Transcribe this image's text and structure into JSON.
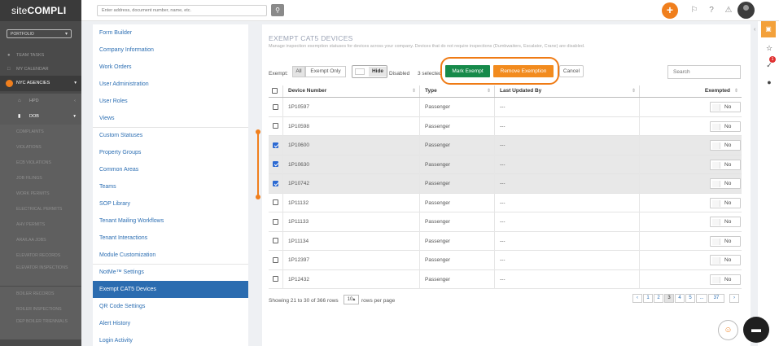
{
  "topbar": {
    "logo_light": "site",
    "logo_bold": "COMPLI",
    "search_placeholder": "Enter address, document number, name, etc.",
    "search_icon": "magnifier",
    "add_label": "+",
    "alert_badge": "1"
  },
  "sidebar": {
    "portfolio_label": "PORTFOLIO",
    "team_tasks": "TEAM TASKS",
    "my_calendar": "MY CALENDAR",
    "nyc_agencies": "NYC AGENCIES",
    "hpd": "HPD",
    "dob": "DOB",
    "items": [
      "COMPLAINTS",
      "VIOLATIONS",
      "ECB VIOLATIONS",
      "JOB FILINGS",
      "WORK PERMITS",
      "ELECTRICAL PERMITS",
      "AHV PERMITS",
      "ARA/LAA JOBS",
      "ELEVATOR RECORDS",
      "ELEVATOR INSPECTIONS",
      "BOILER RECORDS",
      "BOILER INSPECTIONS",
      "DEP BOILER TRIENNIALS"
    ]
  },
  "menu": {
    "items": [
      "Form Builder",
      "Company Information",
      "Work Orders",
      "User Administration",
      "User Roles",
      "Views",
      "Custom Statuses",
      "Property Groups",
      "Common Areas",
      "Teams",
      "SOP Library",
      "Tenant Mailing Workflows",
      "Tenant Interactions",
      "Module Customization",
      "NotMe™ Settings",
      "Exempt CAT5 Devices",
      "QR Code Settings",
      "Alert History",
      "Login Activity"
    ],
    "active": "Exempt CAT5 Devices"
  },
  "page": {
    "title": "EXEMPT CAT5 DEVICES",
    "subtitle": "Manage inspection exemption statuses for devices across your company. Devices that do not require inspections (Dumbwaiters, Escalator, Crane) are disabled.",
    "exempt_label": "Exempt:",
    "all_label": "All",
    "exempt_only_label": "Exempt Only",
    "hide_label": "Hide",
    "disabled_label": "Disabled",
    "selected_text": "3 selected",
    "mark_exempt": "Mark Exempt",
    "remove_exemption": "Remove Exemption",
    "cancel": "Cancel",
    "search_placeholder": "Search"
  },
  "table": {
    "columns": [
      "Device Number",
      "Type",
      "Last Updated By",
      "Exempted"
    ],
    "rows": [
      {
        "device": "1P10597",
        "type": "Passenger",
        "updated": "---",
        "exempted": "No",
        "checked": false
      },
      {
        "device": "1P10598",
        "type": "Passenger",
        "updated": "---",
        "exempted": "No",
        "checked": false
      },
      {
        "device": "1P10600",
        "type": "Passenger",
        "updated": "---",
        "exempted": "No",
        "checked": true
      },
      {
        "device": "1P10630",
        "type": "Passenger",
        "updated": "---",
        "exempted": "No",
        "checked": true
      },
      {
        "device": "1P10742",
        "type": "Passenger",
        "updated": "---",
        "exempted": "No",
        "checked": true
      },
      {
        "device": "1P11132",
        "type": "Passenger",
        "updated": "---",
        "exempted": "No",
        "checked": false
      },
      {
        "device": "1P11133",
        "type": "Passenger",
        "updated": "---",
        "exempted": "No",
        "checked": false
      },
      {
        "device": "1P11134",
        "type": "Passenger",
        "updated": "---",
        "exempted": "No",
        "checked": false
      },
      {
        "device": "1P12397",
        "type": "Passenger",
        "updated": "---",
        "exempted": "No",
        "checked": false
      },
      {
        "device": "1P12432",
        "type": "Passenger",
        "updated": "---",
        "exempted": "No",
        "checked": false
      }
    ]
  },
  "footer": {
    "showing": "Showing 21 to 30 of 366 rows",
    "per_page_value": "10",
    "per_page_label": "rows per page",
    "pages": [
      "‹",
      "1",
      "2",
      "3",
      "4",
      "5",
      "...",
      "37",
      "›"
    ],
    "current_page": "3"
  },
  "colors": {
    "accent_orange": "#f07f1d",
    "mark_green": "#168a4a",
    "active_blue": "#2b6cb0"
  }
}
